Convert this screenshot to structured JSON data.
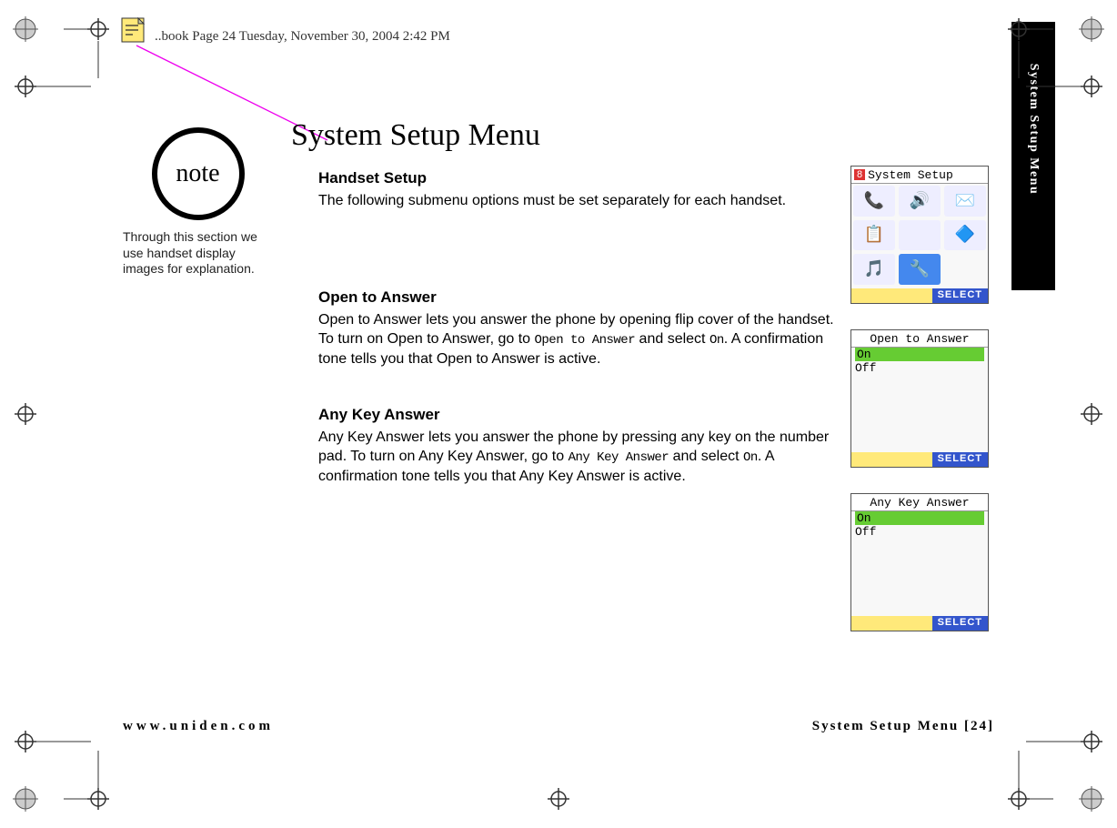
{
  "header_stamp": "..book  Page 24  Tuesday, November 30, 2004  2:42 PM",
  "side_tab": "System Setup Menu",
  "note": {
    "circle": "note",
    "text": "Through this section we use handset display images for explanation."
  },
  "title": "System Setup Menu",
  "sections": {
    "handset": {
      "heading": "Handset Setup",
      "body": "The following submenu options must be set separately for each handset."
    },
    "open_answer": {
      "heading": "Open to Answer",
      "body_pre": "Open to Answer lets you answer the phone by opening flip cover of the handset. To turn on Open to Answer, go to ",
      "mono1": "Open to Answer",
      "body_mid": " and select ",
      "mono2": "On",
      "body_post": ". A confirmation tone tells you that Open to Answer is active."
    },
    "any_key": {
      "heading": "Any Key Answer",
      "body_pre": "Any Key Answer lets you answer the phone by pressing any key on the number pad. To turn on Any Key Answer, go to ",
      "mono1": "Any Key Answer",
      "body_mid": " and select ",
      "mono2": "On",
      "body_post": ". A confirmation tone tells you that Any Key Answer is active."
    }
  },
  "screens": {
    "setup": {
      "badge": "8",
      "title": "System Setup",
      "select": "SELECT"
    },
    "open": {
      "title": "Open to Answer",
      "on": "On",
      "off": "Off",
      "select": "SELECT"
    },
    "anykey": {
      "title": "Any Key Answer",
      "on": "On",
      "off": "Off",
      "select": "SELECT"
    }
  },
  "footer": {
    "left": "www.uniden.com",
    "right": "System Setup Menu [24]"
  }
}
